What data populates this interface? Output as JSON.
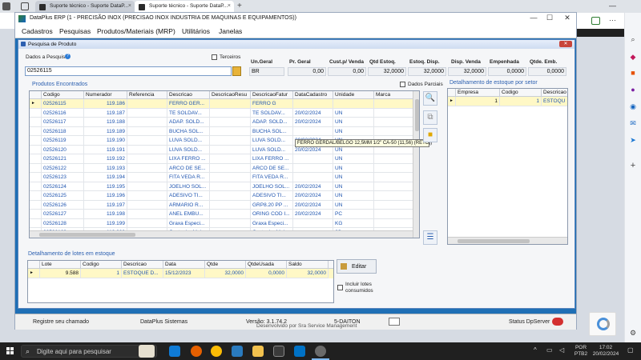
{
  "browser": {
    "tabs": [
      {
        "label": "Suporte técnico - Suporte DataP..."
      },
      {
        "label": "Suporte técnico - Suporte DataP..."
      }
    ],
    "new_tab": "+"
  },
  "app": {
    "title": "DataPlus ERP (1 - PRECISÃO INOX  (PRECISAO INOX INDUSTRIA DE MAQUINAS E EQUIPAMENTOS))",
    "menu": [
      "Cadastros",
      "Pesquisas",
      "Produtos/Materiais (MRP)",
      "Utilitários",
      "Janelas"
    ],
    "status": {
      "register_call": "Registre seu chamado",
      "company": "DataPlus Sistemas",
      "version": "Versão: 3.1.74.2",
      "user": "5-DAITON",
      "server": "Status DpServer"
    }
  },
  "dialog": {
    "title": "Pesquisa de Produto",
    "search_label": "Dados a Pesquisar",
    "search_value": "02526115",
    "terceiros_label": "Terceiros",
    "summary": {
      "headers": [
        "Un.Geral",
        "Pr. Geral",
        "Cust.p/ Venda",
        "Qtd Estoq.",
        "Estoq. Disp.",
        "Disp. Venda",
        "Empenhada",
        "Qtde. Emb."
      ],
      "values": [
        "BR",
        "0,00",
        "0,00",
        "32,0000",
        "32,0000",
        "32,0000",
        "0,0000",
        "0,0000"
      ]
    },
    "products_title": "Produtos Encontrados",
    "partial_label": "Dados Parciais",
    "products_headers": [
      "Codigo",
      "Numerador",
      "Referencia",
      "Descricao",
      "DescricaoResu",
      "DescricaoFatur",
      "DataCadastro",
      "Unidade",
      "Marca"
    ],
    "products": [
      [
        "02526115",
        "119.186",
        "",
        "FERRO GER...",
        "",
        "FERRO G",
        "",
        "",
        ""
      ],
      [
        "02526116",
        "119.187",
        "",
        "TE SOLDAV...",
        "",
        "TE SOLDAV...",
        "20/02/2024",
        "UN",
        ""
      ],
      [
        "02526117",
        "119.188",
        "",
        "ADAP. SOLD...",
        "",
        "ADAP. SOLD...",
        "20/02/2024",
        "UN",
        ""
      ],
      [
        "02526118",
        "119.189",
        "",
        "BUCHA SOL...",
        "",
        "BUCHA SOL...",
        "",
        "UN",
        ""
      ],
      [
        "02526119",
        "119.190",
        "",
        "LUVA SOLD...",
        "",
        "LUVA SOLD...",
        "20/02/2024",
        "UN",
        ""
      ],
      [
        "02526120",
        "119.191",
        "",
        "LUVA SOLD...",
        "",
        "LUVA SOLD...",
        "20/02/2024",
        "UN",
        ""
      ],
      [
        "02526121",
        "119.192",
        "",
        "LIXA FERRO ...",
        "",
        "LIXA FERRO ...",
        "",
        "UN",
        ""
      ],
      [
        "02526122",
        "119.193",
        "",
        "ARCO DE SE...",
        "",
        "ARCO DE SE...",
        "",
        "UN",
        ""
      ],
      [
        "02526123",
        "119.194",
        "",
        "FITA VEDA R...",
        "",
        "FITA VEDA R...",
        "",
        "UN",
        ""
      ],
      [
        "02526124",
        "119.195",
        "",
        "JOELHO SOL...",
        "",
        "JOELHO SOL...",
        "20/02/2024",
        "UN",
        ""
      ],
      [
        "02526125",
        "119.196",
        "",
        "ADESIVO TI...",
        "",
        "ADESIVO TI...",
        "20/02/2024",
        "UN",
        ""
      ],
      [
        "02526126",
        "119.197",
        "",
        "ARMARIO R...",
        "",
        "GRP8.20 PP ...",
        "20/02/2024",
        "UN",
        ""
      ],
      [
        "02526127",
        "119.198",
        "",
        "ANEL EMBU...",
        "",
        "ORING COD I...",
        "20/02/2024",
        "PC",
        ""
      ],
      [
        "02526128",
        "119.199",
        "",
        "Graxa Especi...",
        "",
        "Graxa Especi...",
        "",
        "KG",
        ""
      ],
      [
        "02526129",
        "119.200",
        "",
        "Castanha Mol...",
        "",
        "Castanha Mol...",
        "",
        "JG",
        ""
      ]
    ],
    "tooltip": "FERRO GERDAL/BELGO 12,5MM 1/2\" CA-50 (11,56) (RETO))",
    "stock_title": "Detalhamento de estoque por setor",
    "stock_headers": [
      "Empresa",
      "Codigo",
      "Descricao"
    ],
    "stock_rows": [
      [
        "1",
        "1",
        "ESTOQU"
      ]
    ],
    "lots_title": "Detalhamento de lotes em estoque",
    "lots_headers": [
      "Lote",
      "Codigo",
      "Descricao",
      "Data",
      "Qtde",
      "QtdeUsada",
      "Saldo"
    ],
    "lots_rows": [
      [
        "9.588",
        "1",
        "ESTOQUE D...",
        "15/12/2023",
        "32,0000",
        "0,0000",
        "32,0000"
      ]
    ],
    "edit_button": "Editar",
    "include_consumed": "Incluir lotes consumidos"
  },
  "page_bg": {
    "text": "Desenvolvido por Sra Service Management"
  },
  "taskbar": {
    "search_placeholder": "Digite aqui para pesquisar",
    "lang": "POR",
    "layout": "PTB2",
    "time": "17:02",
    "date": "20/02/2024"
  },
  "colors": {
    "app_blue": "#1f6fb5",
    "link_blue": "#1f55b0",
    "selected_row": "#fff8c6"
  }
}
